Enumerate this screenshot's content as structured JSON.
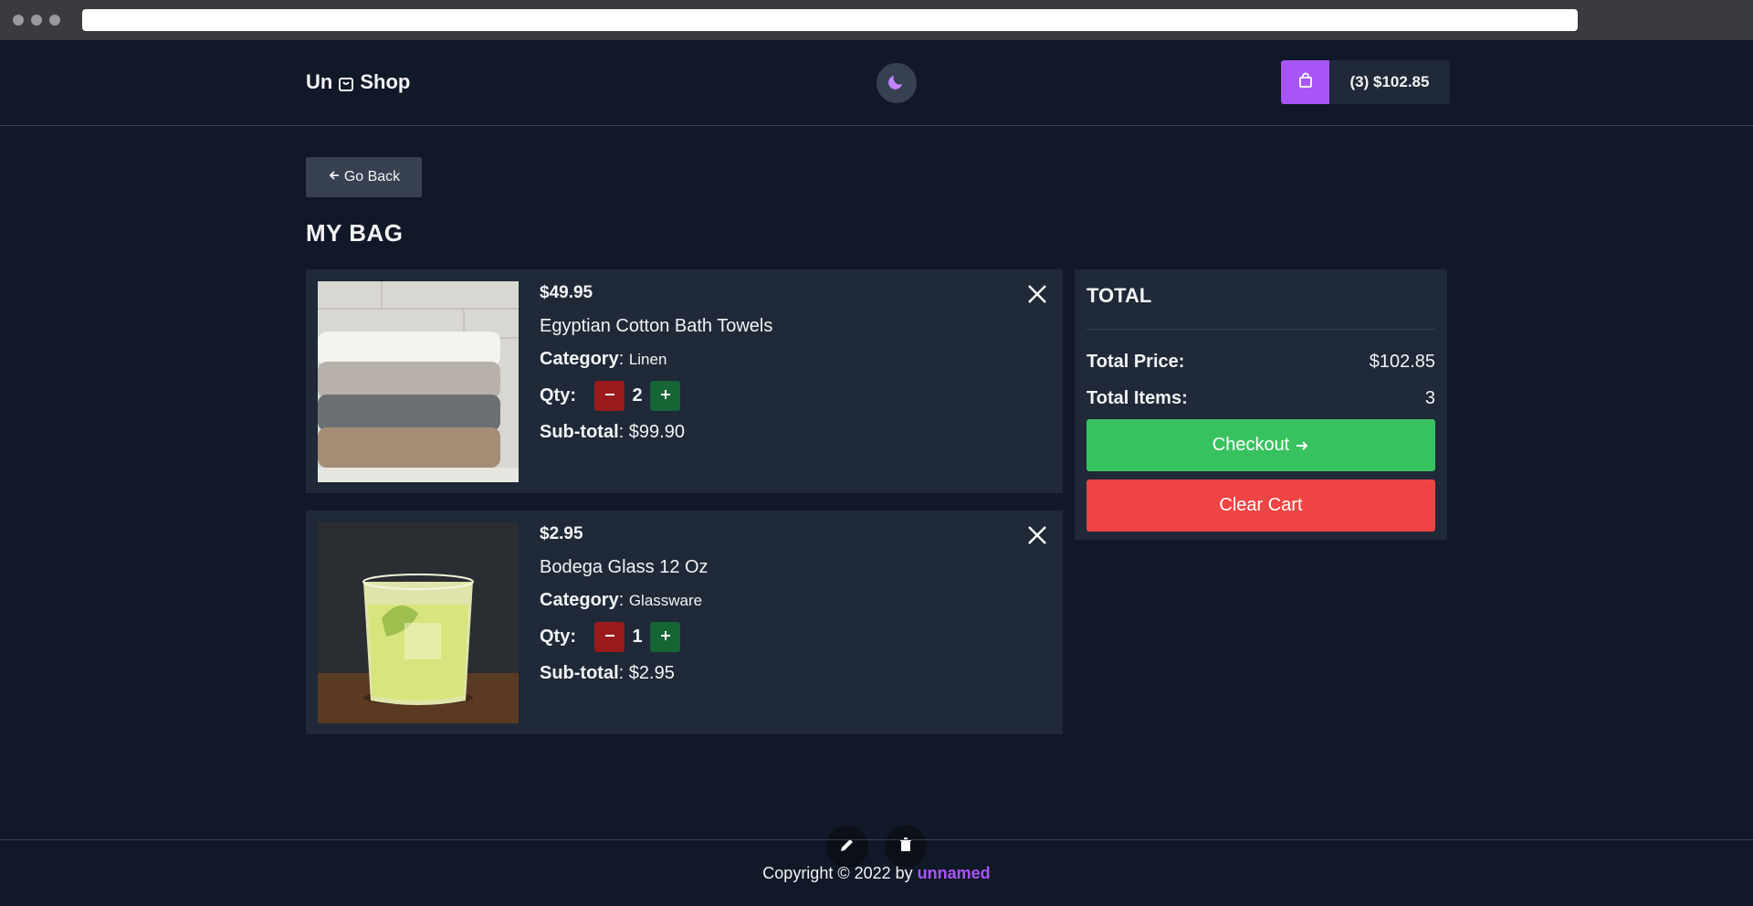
{
  "header": {
    "logo_left": "Un",
    "logo_right": "Shop",
    "cart_summary": "(3) $102.85"
  },
  "nav": {
    "go_back_label": "Go Back"
  },
  "page": {
    "title": "MY BAG"
  },
  "cart": {
    "items": [
      {
        "price": "$49.95",
        "name": "Egyptian Cotton Bath Towels",
        "category_label": "Category",
        "category": "Linen",
        "qty_label": "Qty:",
        "qty": "2",
        "subtotal_label": "Sub-total",
        "subtotal": "$99.90"
      },
      {
        "price": "$2.95",
        "name": "Bodega Glass 12 Oz",
        "category_label": "Category",
        "category": "Glassware",
        "qty_label": "Qty:",
        "qty": "1",
        "subtotal_label": "Sub-total",
        "subtotal": "$2.95"
      }
    ]
  },
  "total": {
    "title": "TOTAL",
    "price_label": "Total Price:",
    "price_value": "$102.85",
    "items_label": "Total Items:",
    "items_value": "3",
    "checkout_label": "Checkout",
    "clear_label": "Clear Cart"
  },
  "footer": {
    "copyright_prefix": "Copyright © 2022 by",
    "brand": "unnamed"
  },
  "colors": {
    "background": "#111827",
    "panel": "#1f2937",
    "accent": "#a855f7",
    "checkout": "#38c25f",
    "clear": "#ef4444"
  }
}
